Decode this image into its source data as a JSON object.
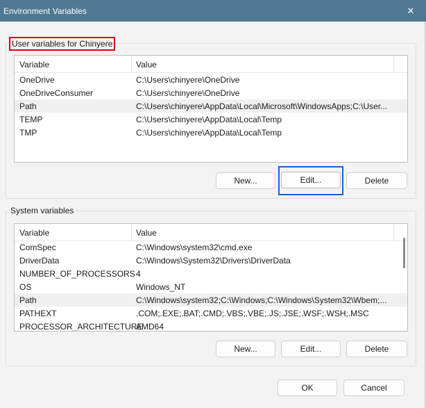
{
  "window": {
    "title": "Environment Variables",
    "close_glyph": "✕"
  },
  "user_vars": {
    "legend": "User variables for Chinyere",
    "columns": {
      "variable": "Variable",
      "value": "Value"
    },
    "rows": [
      {
        "name": "OneDrive",
        "value": "C:\\Users\\chinyere\\OneDrive"
      },
      {
        "name": "OneDriveConsumer",
        "value": "C:\\Users\\chinyere\\OneDrive"
      },
      {
        "name": "Path",
        "value": "C:\\Users\\chinyere\\AppData\\Local\\Microsoft\\WindowsApps;C:\\User..."
      },
      {
        "name": "TEMP",
        "value": "C:\\Users\\chinyere\\AppData\\Local\\Temp"
      },
      {
        "name": "TMP",
        "value": "C:\\Users\\chinyere\\AppData\\Local\\Temp"
      }
    ],
    "buttons": {
      "new": "New...",
      "edit": "Edit...",
      "delete": "Delete"
    }
  },
  "system_vars": {
    "legend": "System variables",
    "columns": {
      "variable": "Variable",
      "value": "Value"
    },
    "rows": [
      {
        "name": "ComSpec",
        "value": "C:\\Windows\\system32\\cmd.exe"
      },
      {
        "name": "DriverData",
        "value": "C:\\Windows\\System32\\Drivers\\DriverData"
      },
      {
        "name": "NUMBER_OF_PROCESSORS",
        "value": "4"
      },
      {
        "name": "OS",
        "value": "Windows_NT"
      },
      {
        "name": "Path",
        "value": "C:\\Windows\\system32;C:\\Windows;C:\\Windows\\System32\\Wbem;..."
      },
      {
        "name": "PATHEXT",
        "value": ".COM;.EXE;.BAT;.CMD;.VBS;.VBE;.JS;.JSE;.WSF;.WSH;.MSC"
      },
      {
        "name": "PROCESSOR_ARCHITECTURE",
        "value": "AMD64"
      }
    ],
    "buttons": {
      "new": "New...",
      "edit": "Edit...",
      "delete": "Delete"
    }
  },
  "dialog_buttons": {
    "ok": "OK",
    "cancel": "Cancel"
  },
  "colors": {
    "titlebar": "#4f7892",
    "legend_highlight": "#e0001a",
    "focus_highlight": "#1a5fd6",
    "selected_row": "#f0f0f0"
  }
}
